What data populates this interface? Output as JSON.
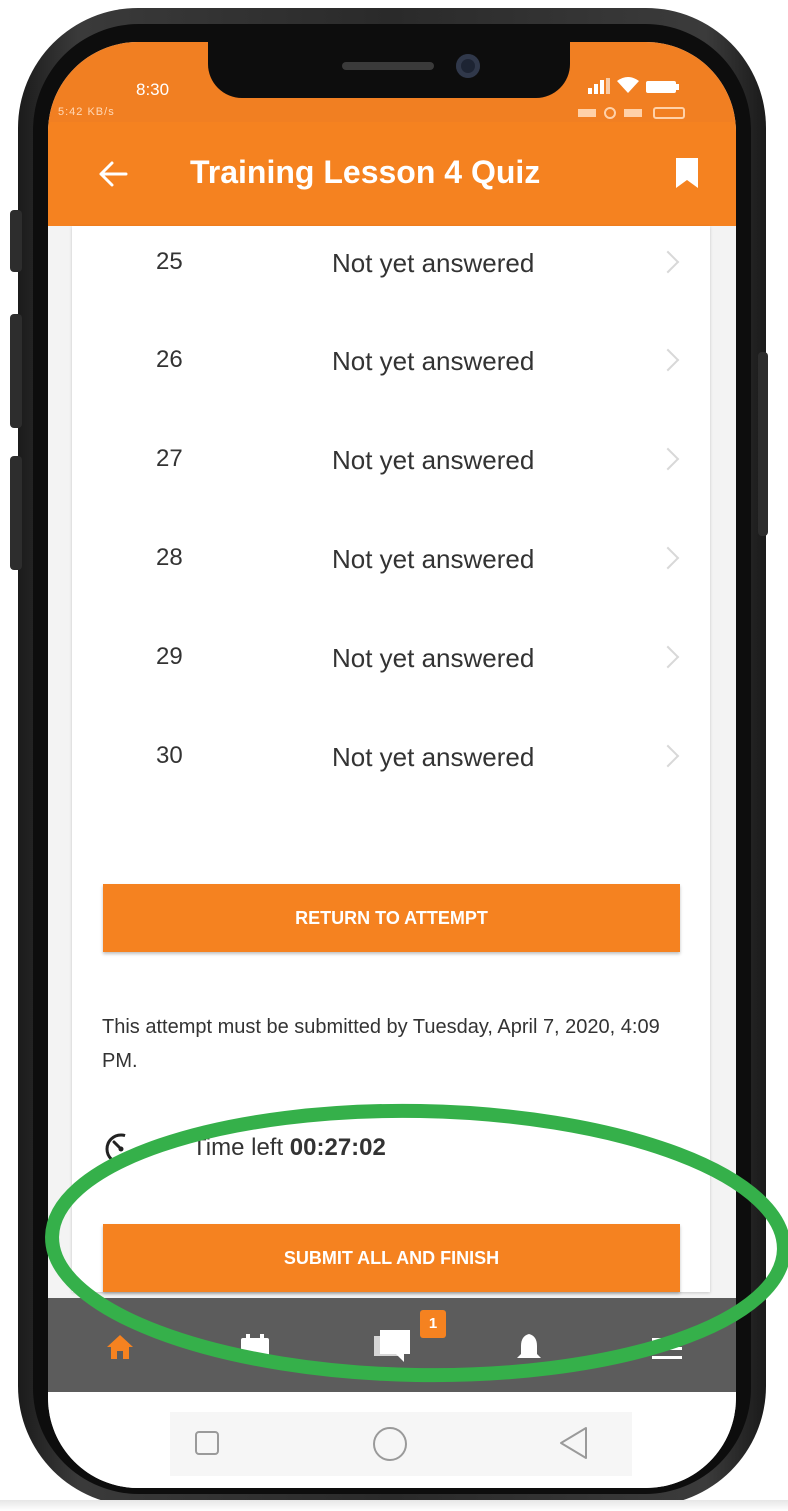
{
  "status_bar": {
    "time": "8:30",
    "overlay_text": "5:42  KB/s"
  },
  "app_bar": {
    "title": "Training Lesson 4 Quiz"
  },
  "questions": [
    {
      "number": "25",
      "status": "Not yet answered"
    },
    {
      "number": "26",
      "status": "Not yet answered"
    },
    {
      "number": "27",
      "status": "Not yet answered"
    },
    {
      "number": "28",
      "status": "Not yet answered"
    },
    {
      "number": "29",
      "status": "Not yet answered"
    },
    {
      "number": "30",
      "status": "Not yet answered"
    }
  ],
  "return_button": "RETURN TO ATTEMPT",
  "deadline_text": "This attempt must be submitted by Tuesday, April 7, 2020, 4:09 PM.",
  "timer": {
    "label": "Time left ",
    "value": "00:27:02"
  },
  "submit_button": "SUBMIT ALL AND FINISH",
  "tab_bar": {
    "messages_badge": "1",
    "tabs": [
      "home-icon",
      "calendar-icon",
      "messages-icon",
      "notifications-icon",
      "menu-icon"
    ],
    "active_color": "#f58220"
  },
  "colors": {
    "accent": "#f58220",
    "highlight_ring": "#35b04a"
  }
}
